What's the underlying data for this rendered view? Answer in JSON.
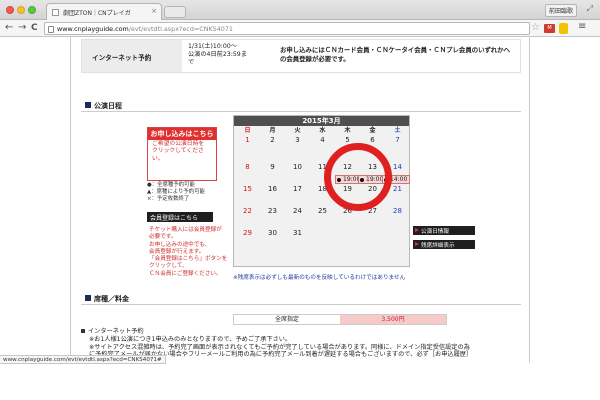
{
  "browser": {
    "tab_title": "劇団ZTON｜CNプレイガ",
    "tab_close": "×",
    "profile_label": "前田臨歌",
    "back": "←",
    "forward": "→",
    "reload": "C",
    "url_host": "www.cnplayguide.com",
    "url_path": "/evt/evtdtl.aspx?ecd=CNKS4071",
    "star": "☆",
    "extension_label": "M",
    "menu": "≡",
    "status_url": "www.cnplayguide.com/evt/evtdtl.aspx?ecd=CNKS4071#"
  },
  "internet": {
    "label": "インターネット予約",
    "date_lines": [
      "1/31(土)10:00～",
      "公演の4日前23:59ま",
      "で"
    ],
    "note": "お申し込みにはＣＮカード会員・ＣＮケータイ会員・ＣＮプレ会員のいずれかへの会員登録が必要です。"
  },
  "schedule": {
    "heading": "公演日程",
    "apply_header": "お申し込みはこちら",
    "apply_instr": [
      "ご希望の公演日時を",
      "クリックしてください。"
    ],
    "legend": [
      "●：全席種予約可能",
      "▲：席種により予約可能",
      "×：予定枚数終了"
    ],
    "register_button": "会員登録はこちら",
    "register_note": [
      "チケット購入には会員登録が",
      "必要です。",
      "お申し込みの途中でも、",
      "会員登録が行えます。",
      "「会員登録はこちら」ボタンを",
      "クリックして、",
      "ＣＮ会員にご登録ください。"
    ],
    "calendar_month": "2015年3月",
    "dow": [
      "日",
      "月",
      "火",
      "水",
      "木",
      "金",
      "土"
    ],
    "weeks": [
      [
        "1",
        "2",
        "3",
        "4",
        "5",
        "6",
        "7"
      ],
      [
        "8",
        "9",
        "10",
        "11",
        "12",
        "13",
        "14"
      ],
      [
        "15",
        "16",
        "17",
        "18",
        "19",
        "20",
        "21"
      ],
      [
        "22",
        "23",
        "24",
        "25",
        "26",
        "27",
        "28"
      ],
      [
        "29",
        "30",
        "31",
        "",
        "",
        "",
        ""
      ]
    ],
    "performances": [
      {
        "time": "19:00",
        "marker": "●"
      },
      {
        "time": "19:00",
        "marker": "●"
      },
      {
        "time": "14:00",
        "marker": "●"
      }
    ],
    "calendar_note": "※残席表示は必ずしも最新のものを反映しているわけではありません",
    "performance_info_button": "公演日情報",
    "seat_detail_button": "残席詳細表示"
  },
  "pricing": {
    "heading": "席種／料金",
    "seat_type": "全席指定",
    "price": "3,500円"
  },
  "inet_booking": {
    "title": "インターネット予約",
    "lines": [
      "※お1人様1公演につき1申込みのみとなりますので、予めご了承下さい。",
      "※サイトアクセス混雑時は、予約完了画面が表示されなくてもご予約が完了している場合があります。同様に、ドメイン指定受信設定の為",
      "に予約完了メールが届かない場合やフリーメールご利用の為に予約完了メール到着が遅延する場合もございますので、必ず［お申込履歴］"
    ]
  },
  "colors": {
    "accent_red": "#e02f2f",
    "nav_dark": "#1f1f1f",
    "section_mark": "#1d2c55"
  }
}
